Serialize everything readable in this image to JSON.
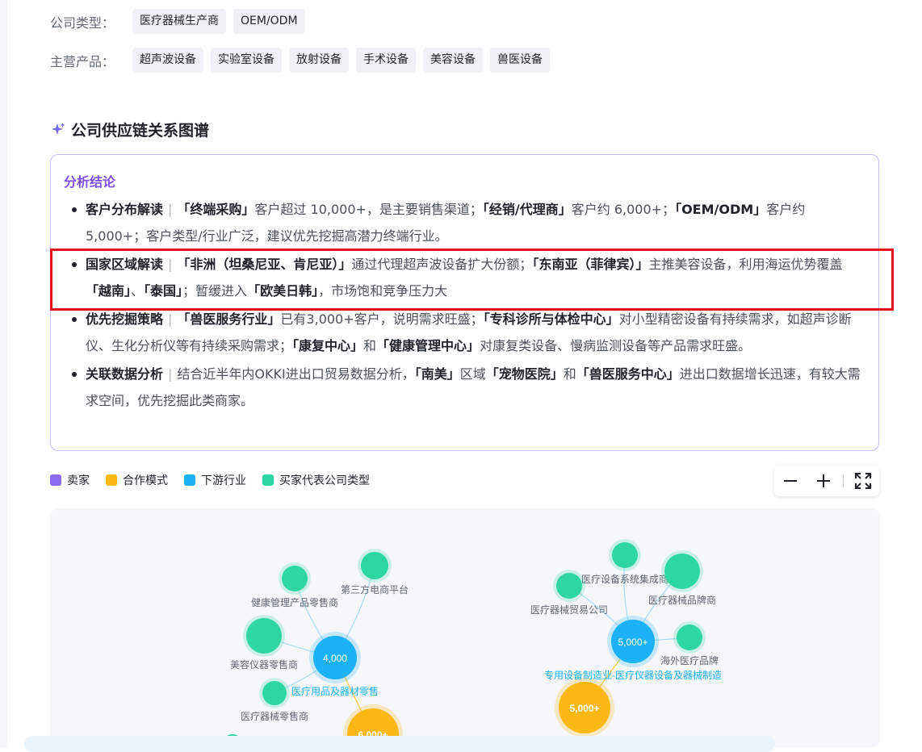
{
  "info_rows": [
    {
      "label": "公司类型：",
      "tags": [
        "医疗器械生产商",
        "OEM/ODM"
      ]
    },
    {
      "label": "主营产品：",
      "tags": [
        "超声波设备",
        "实验室设备",
        "放射设备",
        "手术设备",
        "美容设备",
        "兽医设备"
      ]
    }
  ],
  "section": {
    "title": "公司供应链关系图谱",
    "icon": "sparkle-icon"
  },
  "analysis": {
    "title": "分析结论",
    "items": [
      {
        "head": "客户分布解读",
        "parts": [
          {
            "b": "「终端采购」"
          },
          {
            "t": "客户超过 10,000+，是主要销售渠道；"
          },
          {
            "b": "「经销/代理商」"
          },
          {
            "t": "客户约 6,000+；"
          },
          {
            "b": "「OEM/ODM」"
          },
          {
            "t": "客户约 5,000+；客户类型/行业广泛，建议优先挖掘高潜力终端行业。"
          }
        ]
      },
      {
        "head": "国家区域解读",
        "parts": [
          {
            "b": "「非洲（坦桑尼亚、肯尼亚）」"
          },
          {
            "t": "通过代理超声波设备扩大份额；"
          },
          {
            "b": "「东南亚（菲律宾）」"
          },
          {
            "t": "主推美容设备，利用海运优势覆盖"
          },
          {
            "b": "「越南」"
          },
          {
            "t": "、"
          },
          {
            "b": "「泰国」"
          },
          {
            "t": "；暂缓进入"
          },
          {
            "b": "「欧美日韩」"
          },
          {
            "t": "，市场饱和竞争压力大"
          }
        ]
      },
      {
        "head": "优先挖掘策略",
        "parts": [
          {
            "b": "「兽医服务行业」"
          },
          {
            "t": "已有3,000+客户，说明需求旺盛；"
          },
          {
            "b": "「专科诊所与体检中心」"
          },
          {
            "t": "对小型精密设备有持续需求，如超声诊断仪、生化分析仪等有持续采购需求；"
          },
          {
            "b": "「康复中心」"
          },
          {
            "t": "和"
          },
          {
            "b": "「健康管理中心」"
          },
          {
            "t": "对康复类设备、慢病监测设备等产品需求旺盛。"
          }
        ]
      },
      {
        "head": "关联数据分析",
        "parts": [
          {
            "t": "结合近半年内OKKI进出口贸易数据分析，"
          },
          {
            "b": "「南美」"
          },
          {
            "t": "区域"
          },
          {
            "b": "「宠物医院」"
          },
          {
            "t": "和"
          },
          {
            "b": "「兽医服务中心」"
          },
          {
            "t": "进出口数据增长迅速，有较大需求空间，优先挖掘此类商家。"
          }
        ]
      }
    ]
  },
  "legend": [
    {
      "label": "卖家",
      "color": "#8b6cf0"
    },
    {
      "label": "合作模式",
      "color": "#fdb913"
    },
    {
      "label": "下游行业",
      "color": "#1ab2f5"
    },
    {
      "label": "买家代表公司类型",
      "color": "#2ed7a2"
    }
  ],
  "zoom_controls": {
    "out_icon": "minus-icon",
    "in_icon": "plus-icon",
    "full_icon": "fullscreen-icon"
  },
  "graph": {
    "colors": {
      "buyer": "#2ed7a2",
      "industry": "#1ab2f5",
      "mode": "#fdb913",
      "link": "#a8dcf2"
    },
    "clusters": [
      {
        "industry": {
          "value": "4,000",
          "label": "医疗用品及器材零售"
        },
        "mode": {
          "value": "6,000+"
        },
        "buyers": [
          "健康管理产品零售商",
          "第三方电商平台",
          "美容仪器零售商",
          "医疗器械零售商"
        ]
      },
      {
        "industry": {
          "value": "5,000+",
          "label": "专用设备制造业-医疗仪器设备及器械制造"
        },
        "mode": {
          "value": "5,000+"
        },
        "buyers": [
          "医疗设备系统集成商",
          "医疗器械贸易公司",
          "医疗器械品牌商",
          "海外医疗品牌"
        ]
      }
    ]
  }
}
